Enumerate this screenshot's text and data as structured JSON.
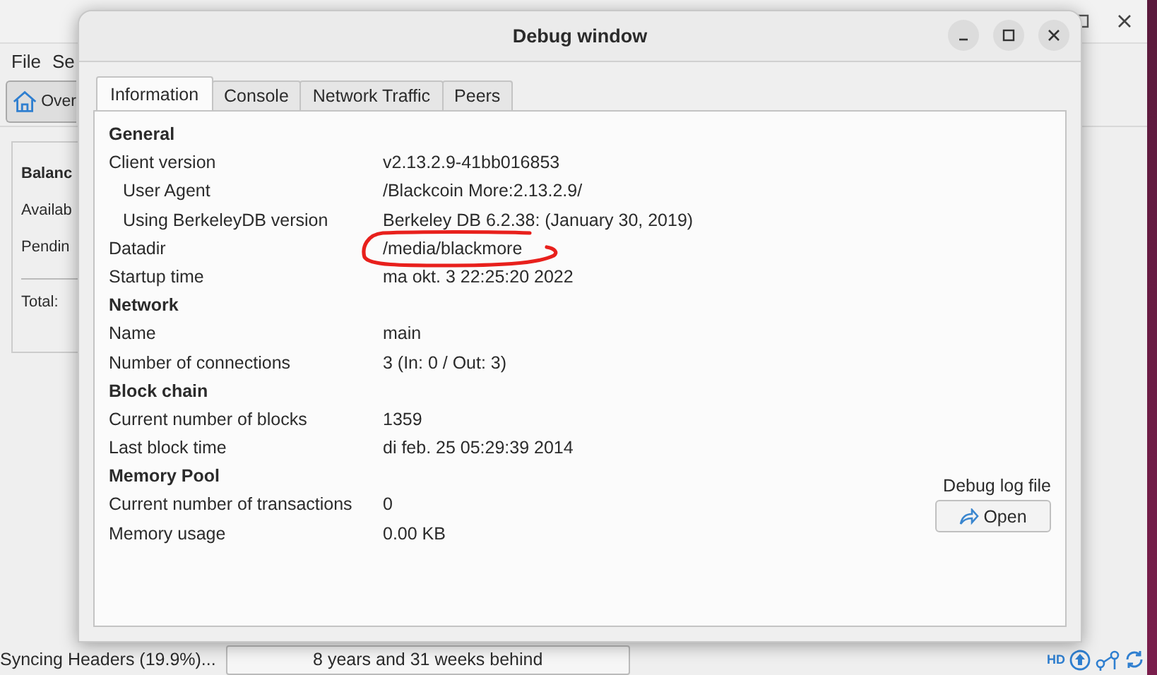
{
  "main_window": {
    "menu": [
      "File",
      "Se"
    ],
    "toolbar": [
      {
        "label": "Over",
        "selected": true
      }
    ],
    "overview": {
      "heading": "Balanc",
      "rows": [
        "Availab",
        "Pendin"
      ],
      "total": "Total:"
    },
    "status_bar": {
      "sync_text": "Syncing Headers (19.9%)...",
      "progress_text": "8 years and 31 weeks behind",
      "level": 0,
      "hd_label": "HD"
    }
  },
  "debug_window": {
    "title": "Debug window",
    "tabs": [
      {
        "label": "Information",
        "selected": true
      },
      {
        "label": "Console",
        "selected": false
      },
      {
        "label": "Network Traffic",
        "selected": false
      },
      {
        "label": "Peers",
        "selected": false
      }
    ],
    "rows": [
      {
        "kind": "heading",
        "label": "General"
      },
      {
        "kind": "row",
        "label": "Client version",
        "value": "v2.13.2.9-41bb016853"
      },
      {
        "kind": "subrow",
        "label": "User Agent",
        "value": "/Blackcoin More:2.13.2.9/"
      },
      {
        "kind": "subrow",
        "label": "Using BerkeleyDB version",
        "value": "Berkeley DB 6.2.38: (January 30, 2019)"
      },
      {
        "kind": "row",
        "label": "Datadir",
        "value": "/media/blackmore",
        "circled": true
      },
      {
        "kind": "row",
        "label": "Startup time",
        "value": "ma okt. 3 22:25:20 2022"
      },
      {
        "kind": "heading",
        "label": "Network"
      },
      {
        "kind": "row",
        "label": "Name",
        "value": "main"
      },
      {
        "kind": "row",
        "label": "Number of connections",
        "value": "3 (In: 0 / Out: 3)"
      },
      {
        "kind": "heading",
        "label": "Block chain"
      },
      {
        "kind": "row",
        "label": "Current number of blocks",
        "value": "1359"
      },
      {
        "kind": "row",
        "label": "Last block time",
        "value": "di feb. 25 05:29:39 2014"
      },
      {
        "kind": "heading",
        "label": "Memory Pool"
      },
      {
        "kind": "row",
        "label": "Current number of transactions",
        "value": "0"
      },
      {
        "kind": "row",
        "label": "Memory usage",
        "value": "0.00 KB"
      }
    ],
    "log_label": "Debug log file",
    "open_button": "Open"
  }
}
